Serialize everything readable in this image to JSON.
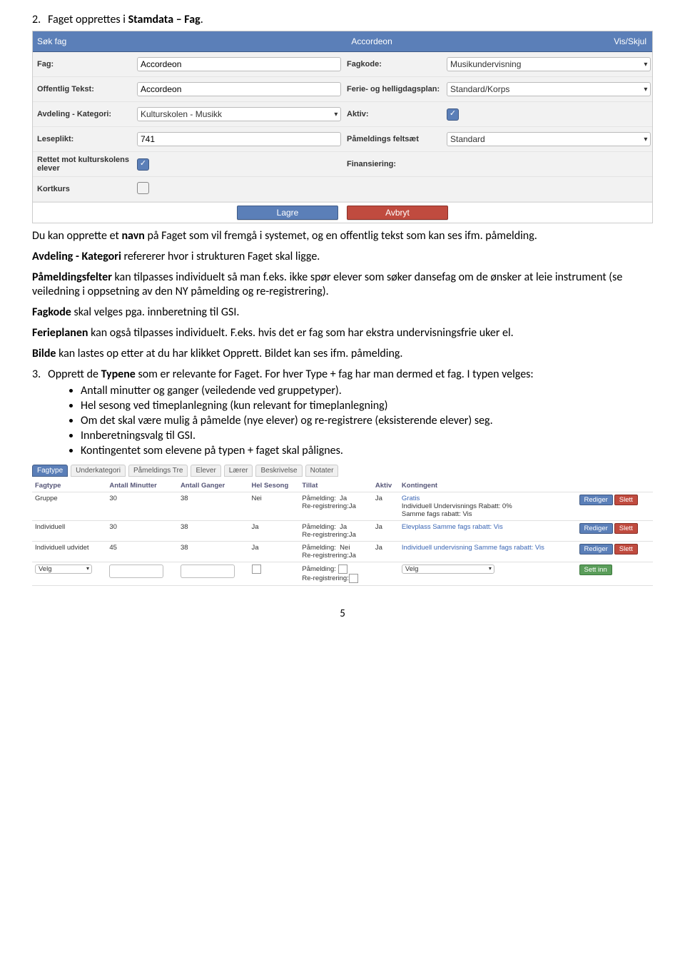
{
  "sec2": {
    "num": "2.",
    "title_a": "Faget opprettes i ",
    "title_b": "Stamdata – Fag",
    "title_c": "."
  },
  "form": {
    "hdr_left": "Søk fag",
    "hdr_center": "Accordeon",
    "hdr_right": "Vis/Skjul",
    "rows": [
      {
        "l1": "Fag:",
        "c1": {
          "t": "text",
          "v": "Accordeon"
        },
        "l2": "Fagkode:",
        "c2": {
          "t": "select",
          "v": "Musikundervisning"
        }
      },
      {
        "l1": "Offentlig Tekst:",
        "c1": {
          "t": "text",
          "v": "Accordeon"
        },
        "l2": "Ferie- og helligdagsplan:",
        "c2": {
          "t": "select",
          "v": "Standard/Korps"
        }
      },
      {
        "l1": "Avdeling - Kategori:",
        "c1": {
          "t": "select",
          "v": "Kulturskolen - Musikk"
        },
        "l2": "Aktiv:",
        "c2": {
          "t": "check",
          "on": true
        }
      },
      {
        "l1": "Leseplikt:",
        "c1": {
          "t": "text",
          "v": "741"
        },
        "l2": "Påmeldings feltsæt",
        "c2": {
          "t": "select",
          "v": "Standard"
        }
      },
      {
        "l1": "Rettet mot kulturskolens elever",
        "c1": {
          "t": "check",
          "on": true
        },
        "l2": "Finansiering:",
        "c2": {
          "t": "blank"
        }
      },
      {
        "l1": "Kortkurs",
        "c1": {
          "t": "check",
          "on": false
        }
      }
    ],
    "btn_save": "Lagre",
    "btn_cancel": "Avbryt"
  },
  "body": {
    "p1_a": "Du kan opprette et ",
    "p1_b": "navn",
    "p1_c": " på Faget som vil fremgå i systemet, og en offentlig tekst som kan ses ifm. påmelding.",
    "p2_a": "Avdeling - Kategori",
    "p2_b": " refererer hvor i strukturen Faget skal ligge.",
    "p3_a": "Påmeldingsfelter",
    "p3_b": " kan tilpasses individuelt så man f.eks. ikke spør elever som søker dansefag om de ønsker at leie instrument (se veiledning i oppsetning av den NY påmelding og re-registrering).",
    "p4_a": "Fagkode",
    "p4_b": " skal velges pga. innberetning til GSI.",
    "p5_a": "Ferieplanen",
    "p5_b": " kan også tilpasses individuelt. F.eks. hvis det er fag som har ekstra undervisningsfrie uker el.",
    "p6_a": "Bilde",
    "p6_b": " kan lastes op etter at du har klikket Opprett. Bildet kan ses ifm. påmelding.",
    "li3_num": "3.",
    "li3_a": "Opprett de ",
    "li3_b": "Typene",
    "li3_c": " som er relevante for Faget. For hver Type + fag har man dermed et fag. I typen velges:",
    "bul": [
      "Antall minutter og ganger (veiledende ved gruppetyper).",
      "Hel sesong ved timeplanlegning (kun relevant for timeplanlegning)",
      "Om det skal være mulig å påmelde (nye elever) og re-registrere (eksisterende elever) seg.",
      "Innberetningsvalg til GSI.",
      "Kontingentet som elevene på typen + faget skal pålignes."
    ]
  },
  "tabs": [
    "Fagtype",
    "Underkategori",
    "Påmeldings Tre",
    "Elever",
    "Lærer",
    "Beskrivelse",
    "Notater"
  ],
  "table": {
    "headers": [
      "Fagtype",
      "Antall Minutter",
      "Antall Ganger",
      "Hel Sesong",
      "Tillat",
      "Aktiv",
      "Kontingent",
      ""
    ],
    "rows": [
      {
        "ft": "Gruppe",
        "min": "30",
        "gang": "38",
        "hel": "Nei",
        "t1": "Påmelding:",
        "t1v": "Ja",
        "t2": "Re-registrering:",
        "t2v": "Ja",
        "akt": "Ja",
        "kont": [
          "Gratis",
          "Individuell Undervisnings Rabatt: 0%",
          "Samme fags rabatt: Vis"
        ],
        "act": "edit"
      },
      {
        "ft": "Individuell",
        "min": "30",
        "gang": "38",
        "hel": "Ja",
        "t1": "Påmelding:",
        "t1v": "Ja",
        "t2": "Re-registrering:",
        "t2v": "Ja",
        "akt": "Ja",
        "kont": [
          "Elevplass Samme fags rabatt: Vis"
        ],
        "act": "edit"
      },
      {
        "ft": "Individuell udvidet",
        "min": "45",
        "gang": "38",
        "hel": "Ja",
        "t1": "Påmelding:",
        "t1v": "Nei",
        "t2": "Re-registrering:",
        "t2v": "Ja",
        "akt": "Ja",
        "kont": [
          "Individuell undervisning Samme fags rabatt: Vis"
        ],
        "act": "edit"
      }
    ],
    "newrow": {
      "sel": "Velg",
      "t1": "Påmelding:",
      "t2": "Re-registrering:",
      "sel2": "Velg",
      "btn": "Sett inn"
    },
    "btn_edit": "Rediger",
    "btn_del": "Slett"
  },
  "pgnum": "5"
}
